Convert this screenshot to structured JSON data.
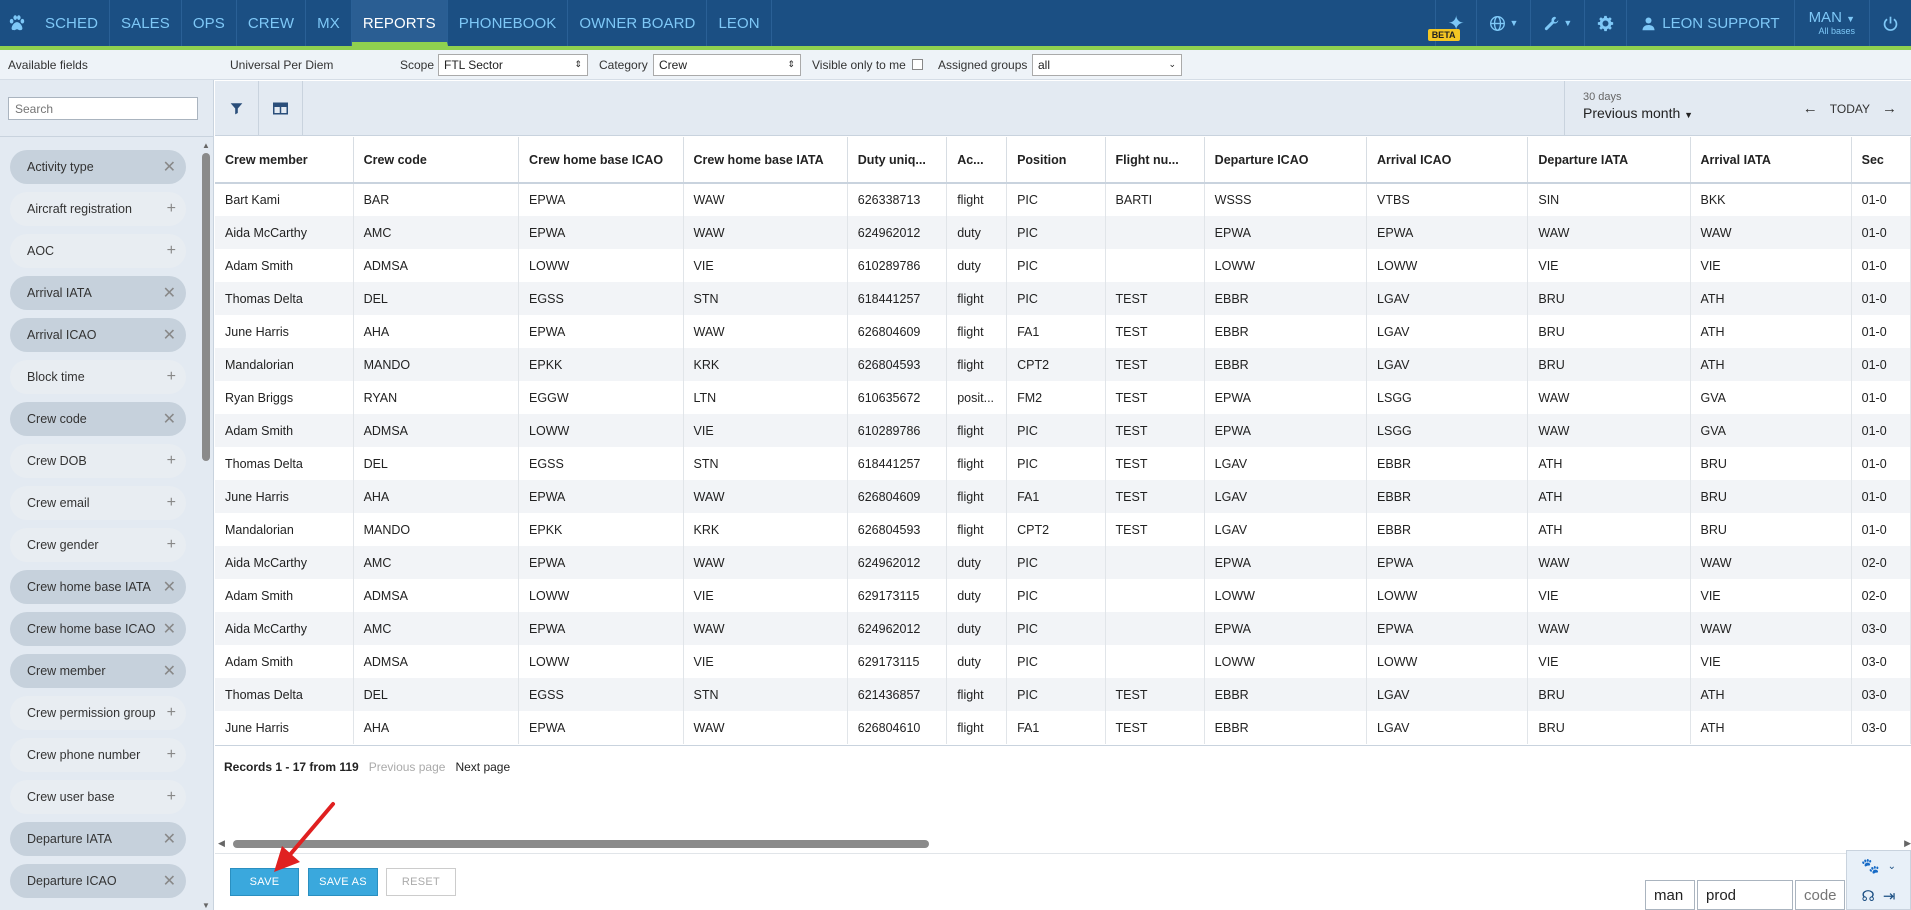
{
  "nav": {
    "items": [
      "SCHED",
      "SALES",
      "OPS",
      "CREW",
      "MX",
      "REPORTS",
      "PHONEBOOK",
      "OWNER BOARD",
      "LEON"
    ],
    "active": "REPORTS",
    "beta": "BETA",
    "user": "LEON SUPPORT",
    "base": "MAN",
    "base_sub": "All bases"
  },
  "filters": {
    "available_fields": "Available fields",
    "report_name": "Universal Per Diem",
    "scope_label": "Scope",
    "scope_value": "FTL Sector",
    "category_label": "Category",
    "category_value": "Crew",
    "visible_label": "Visible only to me",
    "assigned_label": "Assigned groups",
    "assigned_value": "all"
  },
  "sidebar": {
    "search_placeholder": "Search",
    "fields": [
      {
        "label": "Activity type",
        "on": true
      },
      {
        "label": "Aircraft registration",
        "on": false
      },
      {
        "label": "AOC",
        "on": false
      },
      {
        "label": "Arrival IATA",
        "on": true
      },
      {
        "label": "Arrival ICAO",
        "on": true
      },
      {
        "label": "Block time",
        "on": false
      },
      {
        "label": "Crew code",
        "on": true
      },
      {
        "label": "Crew DOB",
        "on": false
      },
      {
        "label": "Crew email",
        "on": false
      },
      {
        "label": "Crew gender",
        "on": false
      },
      {
        "label": "Crew home base IATA",
        "on": true
      },
      {
        "label": "Crew home base ICAO",
        "on": true
      },
      {
        "label": "Crew member",
        "on": true
      },
      {
        "label": "Crew permission group",
        "on": false
      },
      {
        "label": "Crew phone number",
        "on": false
      },
      {
        "label": "Crew user base",
        "on": false
      },
      {
        "label": "Departure IATA",
        "on": true
      },
      {
        "label": "Departure ICAO",
        "on": true
      }
    ]
  },
  "period": {
    "small": "30 days",
    "label": "Previous month",
    "today": "TODAY"
  },
  "table": {
    "columns": [
      "Crew member",
      "Crew code",
      "Crew home base ICAO",
      "Crew home base IATA",
      "Duty uniq...",
      "Ac...",
      "Position",
      "Flight nu...",
      "Departure ICAO",
      "Arrival ICAO",
      "Departure IATA",
      "Arrival IATA",
      "Sec"
    ],
    "rows": [
      [
        "Bart Kami",
        "BAR",
        "EPWA",
        "WAW",
        "626338713",
        "flight",
        "PIC",
        "BARTI",
        "WSSS",
        "VTBS",
        "SIN",
        "BKK",
        "01-0"
      ],
      [
        "Aida McCarthy",
        "AMC",
        "EPWA",
        "WAW",
        "624962012",
        "duty",
        "PIC",
        "",
        "EPWA",
        "EPWA",
        "WAW",
        "WAW",
        "01-0"
      ],
      [
        "Adam Smith",
        "ADMSA",
        "LOWW",
        "VIE",
        "610289786",
        "duty",
        "PIC",
        "",
        "LOWW",
        "LOWW",
        "VIE",
        "VIE",
        "01-0"
      ],
      [
        "Thomas Delta",
        "DEL",
        "EGSS",
        "STN",
        "618441257",
        "flight",
        "PIC",
        "TEST",
        "EBBR",
        "LGAV",
        "BRU",
        "ATH",
        "01-0"
      ],
      [
        "June Harris",
        "AHA",
        "EPWA",
        "WAW",
        "626804609",
        "flight",
        "FA1",
        "TEST",
        "EBBR",
        "LGAV",
        "BRU",
        "ATH",
        "01-0"
      ],
      [
        "Mandalorian",
        "MANDO",
        "EPKK",
        "KRK",
        "626804593",
        "flight",
        "CPT2",
        "TEST",
        "EBBR",
        "LGAV",
        "BRU",
        "ATH",
        "01-0"
      ],
      [
        "Ryan Briggs",
        "RYAN",
        "EGGW",
        "LTN",
        "610635672",
        "posit...",
        "FM2",
        "TEST",
        "EPWA",
        "LSGG",
        "WAW",
        "GVA",
        "01-0"
      ],
      [
        "Adam Smith",
        "ADMSA",
        "LOWW",
        "VIE",
        "610289786",
        "flight",
        "PIC",
        "TEST",
        "EPWA",
        "LSGG",
        "WAW",
        "GVA",
        "01-0"
      ],
      [
        "Thomas Delta",
        "DEL",
        "EGSS",
        "STN",
        "618441257",
        "flight",
        "PIC",
        "TEST",
        "LGAV",
        "EBBR",
        "ATH",
        "BRU",
        "01-0"
      ],
      [
        "June Harris",
        "AHA",
        "EPWA",
        "WAW",
        "626804609",
        "flight",
        "FA1",
        "TEST",
        "LGAV",
        "EBBR",
        "ATH",
        "BRU",
        "01-0"
      ],
      [
        "Mandalorian",
        "MANDO",
        "EPKK",
        "KRK",
        "626804593",
        "flight",
        "CPT2",
        "TEST",
        "LGAV",
        "EBBR",
        "ATH",
        "BRU",
        "01-0"
      ],
      [
        "Aida McCarthy",
        "AMC",
        "EPWA",
        "WAW",
        "624962012",
        "duty",
        "PIC",
        "",
        "EPWA",
        "EPWA",
        "WAW",
        "WAW",
        "02-0"
      ],
      [
        "Adam Smith",
        "ADMSA",
        "LOWW",
        "VIE",
        "629173115",
        "duty",
        "PIC",
        "",
        "LOWW",
        "LOWW",
        "VIE",
        "VIE",
        "02-0"
      ],
      [
        "Aida McCarthy",
        "AMC",
        "EPWA",
        "WAW",
        "624962012",
        "duty",
        "PIC",
        "",
        "EPWA",
        "EPWA",
        "WAW",
        "WAW",
        "03-0"
      ],
      [
        "Adam Smith",
        "ADMSA",
        "LOWW",
        "VIE",
        "629173115",
        "duty",
        "PIC",
        "",
        "LOWW",
        "LOWW",
        "VIE",
        "VIE",
        "03-0"
      ],
      [
        "Thomas Delta",
        "DEL",
        "EGSS",
        "STN",
        "621436857",
        "flight",
        "PIC",
        "TEST",
        "EBBR",
        "LGAV",
        "BRU",
        "ATH",
        "03-0"
      ],
      [
        "June Harris",
        "AHA",
        "EPWA",
        "WAW",
        "626804610",
        "flight",
        "FA1",
        "TEST",
        "EBBR",
        "LGAV",
        "BRU",
        "ATH",
        "03-0"
      ]
    ]
  },
  "pager": {
    "records": "Records 1 - 17 from 119",
    "prev": "Previous page",
    "next": "Next page"
  },
  "buttons": {
    "save": "SAVE",
    "save_as": "SAVE AS",
    "reset": "RESET"
  },
  "login": {
    "user": "man",
    "env": "prod",
    "code_placeholder": "code"
  },
  "colors": {
    "nav_bg": "#1b4f83",
    "accent_green": "#8fd14f",
    "primary_button": "#3aa8dd",
    "annotation_arrow": "#e02020"
  }
}
